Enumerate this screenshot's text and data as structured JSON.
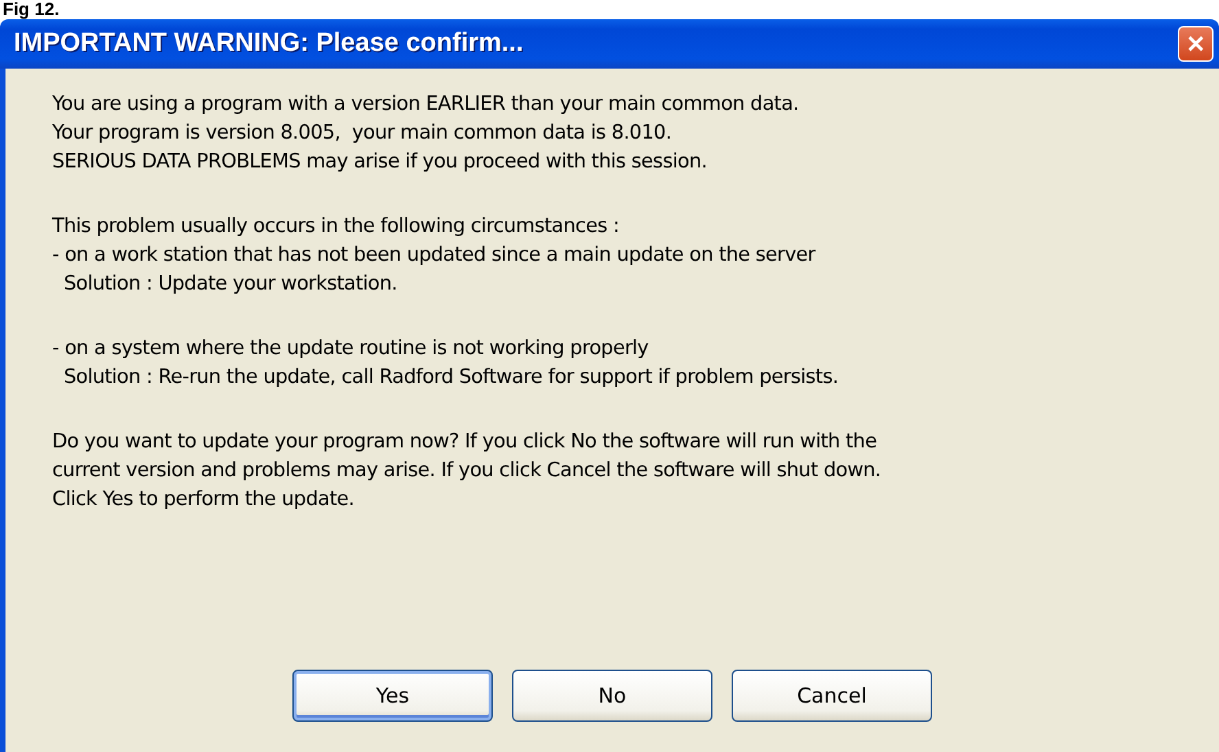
{
  "caption": "Fig 12.",
  "window": {
    "title": "IMPORTANT WARNING: Please confirm...",
    "close": "✕"
  },
  "message": [
    [
      "You are using a program with a version EARLIER than your main common data.",
      "Your program is version 8.005,  your main common data is 8.010.",
      "SERIOUS DATA PROBLEMS may arise if you proceed with this session."
    ],
    [
      "This problem usually occurs in the following circumstances :",
      "- on a work station that has not been updated since a main update on the server",
      "  Solution : Update your workstation."
    ],
    [
      "- on a system where the update routine is not working properly",
      "  Solution : Re-run the update, call Radford Software for support if problem persists."
    ],
    [
      "Do you want to update your program now? If you click No the software will run with the",
      "current version and problems may arise. If you click Cancel the software will shut down.",
      "Click Yes to perform the update."
    ]
  ],
  "buttons": [
    {
      "label": "Yes",
      "selected": true
    },
    {
      "label": "No",
      "selected": false
    },
    {
      "label": "Cancel",
      "selected": false
    }
  ]
}
